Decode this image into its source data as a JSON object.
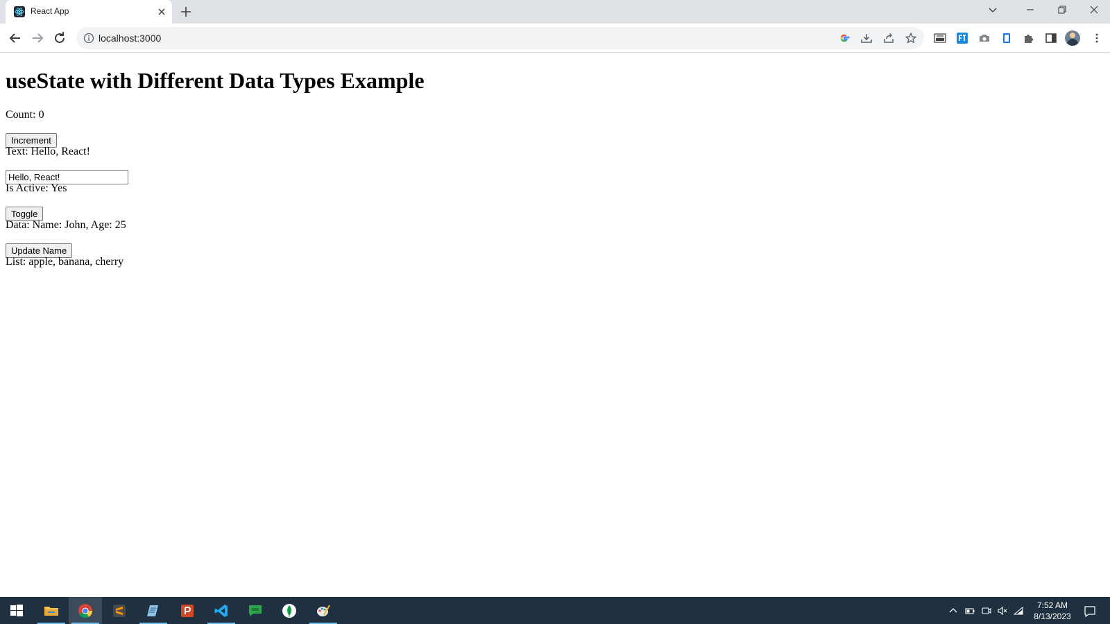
{
  "browser": {
    "tab": {
      "title": "React App",
      "favicon": "react-icon"
    },
    "address": {
      "url": "localhost:3000"
    },
    "accent_color": "#1a73e8",
    "chrome_color": "#dee1e6"
  },
  "page": {
    "heading": "useState with Different Data Types Example",
    "count_text": "Count: 0",
    "increment_label": "Increment",
    "text_display": "Text: Hello, React!",
    "text_input_value": "Hello, React!",
    "active_text": "Is Active: Yes",
    "toggle_label": "Toggle",
    "data_text": "Data: Name: John, Age: 25",
    "update_name_label": "Update Name",
    "list_text": "List: apple, banana, cherry"
  },
  "taskbar": {
    "apps": [
      "start-icon",
      "file-explorer-icon",
      "chrome-icon",
      "sublime-text-icon",
      "notepad-icon",
      "powerpoint-icon",
      "vscode-icon",
      "chat-icon",
      "mongodb-icon",
      "paint-icon"
    ],
    "time": "7:52 AM",
    "date": "8/13/2023",
    "background_color": "#1f3040"
  }
}
